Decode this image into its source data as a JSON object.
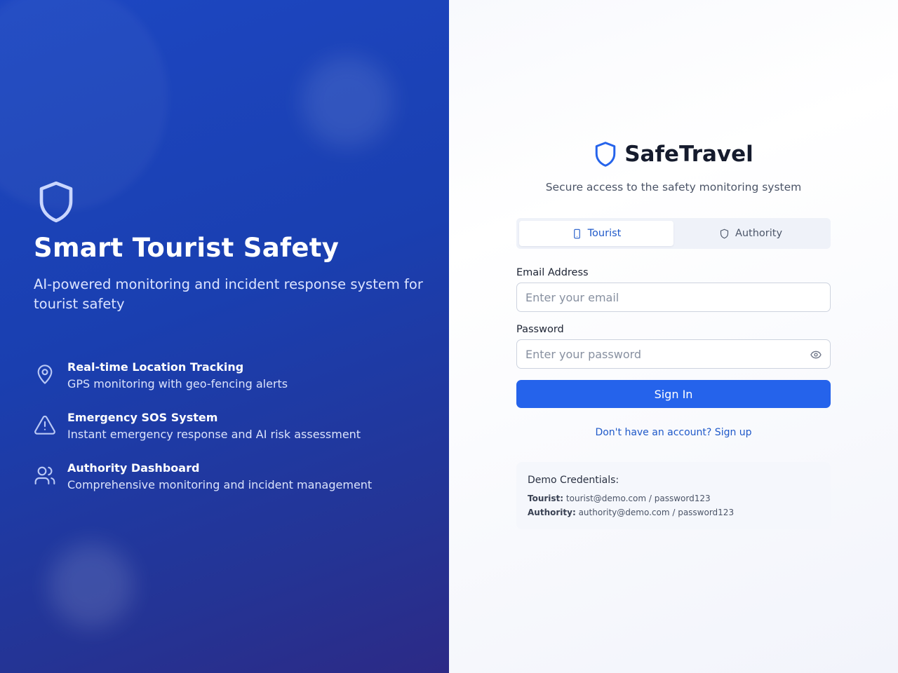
{
  "hero": {
    "title": "Smart Tourist Safety",
    "subtitle": "AI-powered monitoring and incident response system for tourist safety",
    "features": [
      {
        "icon": "map-pin-icon",
        "title": "Real-time Location Tracking",
        "description": "GPS monitoring with geo-fencing alerts"
      },
      {
        "icon": "alert-triangle-icon",
        "title": "Emergency SOS System",
        "description": "Instant emergency response and AI risk assessment"
      },
      {
        "icon": "users-icon",
        "title": "Authority Dashboard",
        "description": "Comprehensive monitoring and incident management"
      }
    ]
  },
  "brand": {
    "name": "SafeTravel",
    "tagline": "Secure access to the safety monitoring system"
  },
  "tabs": [
    {
      "label": "Tourist",
      "icon": "smartphone-icon",
      "active": true
    },
    {
      "label": "Authority",
      "icon": "shield-icon",
      "active": false
    }
  ],
  "form": {
    "email_label": "Email Address",
    "email_placeholder": "Enter your email",
    "email_value": "",
    "password_label": "Password",
    "password_placeholder": "Enter your password",
    "password_value": "",
    "submit_label": "Sign In",
    "signup_link": "Don't have an account? Sign up"
  },
  "demo": {
    "title": "Demo Credentials:",
    "tourist_label": "Tourist:",
    "tourist_value": "tourist@demo.com / password123",
    "authority_label": "Authority:",
    "authority_value": "authority@demo.com / password123"
  },
  "colors": {
    "accent": "#2563eb",
    "link": "#1f59c9",
    "hero_start": "#1d47c2",
    "hero_end": "#2c2a86"
  }
}
